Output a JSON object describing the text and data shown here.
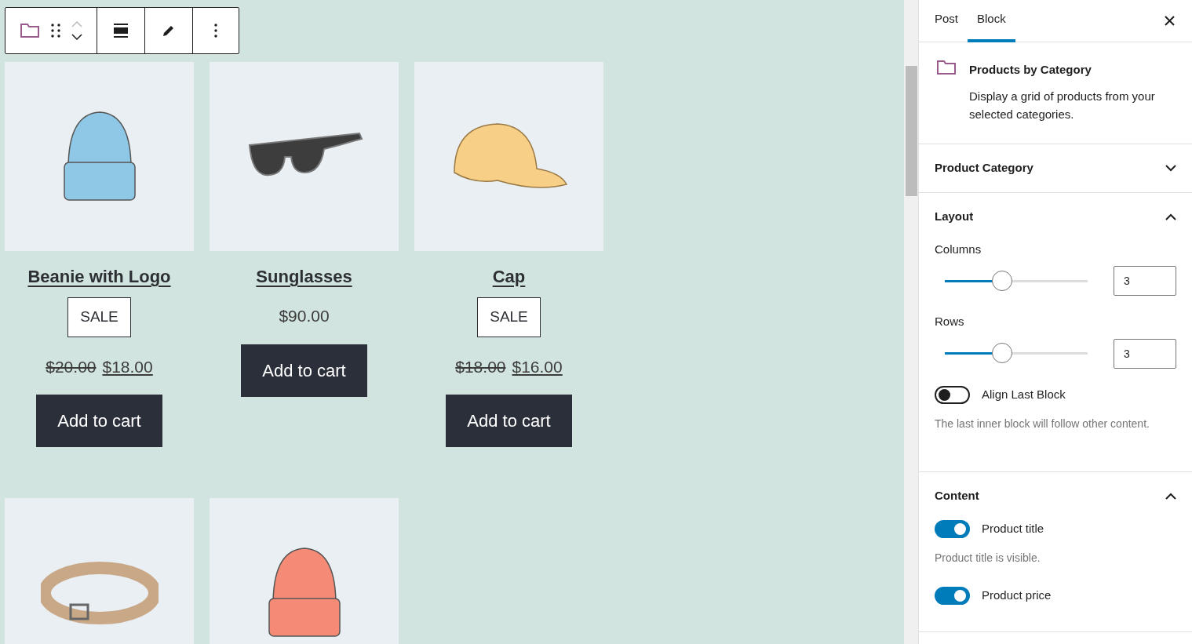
{
  "products": [
    {
      "kind": "beanie",
      "color": "#8ec8e6",
      "title": "Beanie with Logo",
      "badge": "SALE",
      "old_price": "$20.00",
      "price": "$18.00",
      "button": "Add to cart"
    },
    {
      "kind": "sunglasses",
      "title": "Sunglasses",
      "price": "$90.00",
      "button": "Add to cart"
    },
    {
      "kind": "cap",
      "title": "Cap",
      "badge": "SALE",
      "old_price": "$18.00",
      "price": "$16.00",
      "button": "Add to cart"
    },
    {
      "kind": "belt"
    },
    {
      "kind": "beanie",
      "color": "#f58b76"
    }
  ],
  "sidebar": {
    "tabs": [
      {
        "label": "Post",
        "selected": false
      },
      {
        "label": "Block",
        "selected": true
      }
    ],
    "block": {
      "title": "Products by Category",
      "description": "Display a grid of products from your selected categories."
    },
    "panels": [
      {
        "title": "Product Category",
        "expanded": false
      },
      {
        "title": "Layout",
        "expanded": true,
        "controls": [
          {
            "kind": "slider",
            "label": "Columns",
            "level": 0.4,
            "value": "3"
          },
          {
            "kind": "slider",
            "label": "Rows",
            "level": 0.4,
            "value": "3"
          },
          {
            "kind": "toggle",
            "label": "Align Last Block",
            "on": false,
            "help": "The last inner block will follow other content."
          }
        ]
      },
      {
        "title": "Content",
        "expanded": true,
        "controls": [
          {
            "kind": "toggle",
            "label": "Product title",
            "on": true,
            "help": "Product title is visible."
          },
          {
            "kind": "toggle",
            "label": "Product price",
            "on": true
          }
        ]
      }
    ]
  }
}
